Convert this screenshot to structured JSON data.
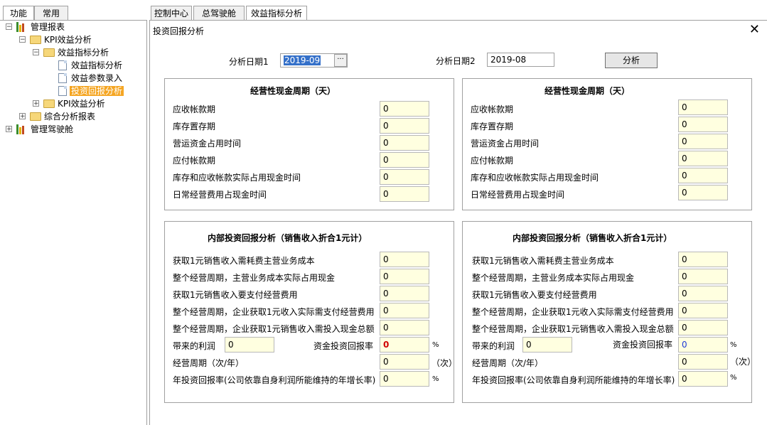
{
  "left_tabs": [
    "功能",
    "常用"
  ],
  "tree": {
    "root1": "管理报表",
    "kpi_analysis": "KPI效益分析",
    "indicator_analysis": "效益指标分析",
    "leaf1": "效益指标分析",
    "leaf2": "效益参数录入",
    "leaf3": "投资回报分析",
    "kpi_analysis2": "KPI效益分析",
    "combined": "综合分析报表",
    "root2": "管理驾驶舱"
  },
  "top_tabs": [
    "控制中心",
    "总驾驶舱",
    "效益指标分析"
  ],
  "dialog": {
    "title": "投资回报分析",
    "close_symbol": "✕",
    "date1_label": "分析日期1",
    "date1_value": "2019-09",
    "ellipsis": "···",
    "date2_label": "分析日期2",
    "date2_value": "2019-08",
    "analyze_button": "分析"
  },
  "cash_cycle": {
    "title": "经营性现金周期（天）",
    "rows": [
      "应收帐款期",
      "库存置存期",
      "营运资金占用时间",
      "应付帐款期",
      "库存和应收帐款实际占用现金时间",
      "日常经营费用占现金时间"
    ],
    "left_values": [
      "0",
      "0",
      "0",
      "0",
      "0",
      "0"
    ],
    "right_values": [
      "0",
      "0",
      "0",
      "0",
      "0",
      "0"
    ]
  },
  "roi": {
    "title": "内部投资回报分析（销售收入折合1元计）",
    "rows": [
      "获取1元销售收入需耗费主营业务成本",
      "整个经营周期，主营业务成本实际占用现金",
      "获取1元销售收入要支付经营费用",
      "整个经营周期，企业获取1元收入实际需支付经营费用",
      "整个经营周期，企业获取1元销售收入需投入现金总额"
    ],
    "left_values": [
      "0",
      "0",
      "0",
      "0",
      "0"
    ],
    "right_values": [
      "0",
      "0",
      "0",
      "0",
      "0"
    ],
    "profit_label": "带来的利润",
    "profit_left": "0",
    "profit_right": "0",
    "capital_roi_label": "资金投资回报率",
    "capital_roi_left": "0",
    "capital_roi_right": "0",
    "percent": "%",
    "cycle_label": "经营周期（次/年）",
    "cycle_left": "0",
    "cycle_right": "0",
    "times_unit": "（次）",
    "annual_label": "年投资回报率(公司依靠自身利润所能维持的年增长率)",
    "annual_left": "0",
    "annual_right": "0"
  },
  "colors": {
    "selected_tree_bg": "#f5a623",
    "input_bg": "#ffffe0",
    "roi_left_color": "#d00000",
    "roi_right_color": "#1e3ad6"
  }
}
